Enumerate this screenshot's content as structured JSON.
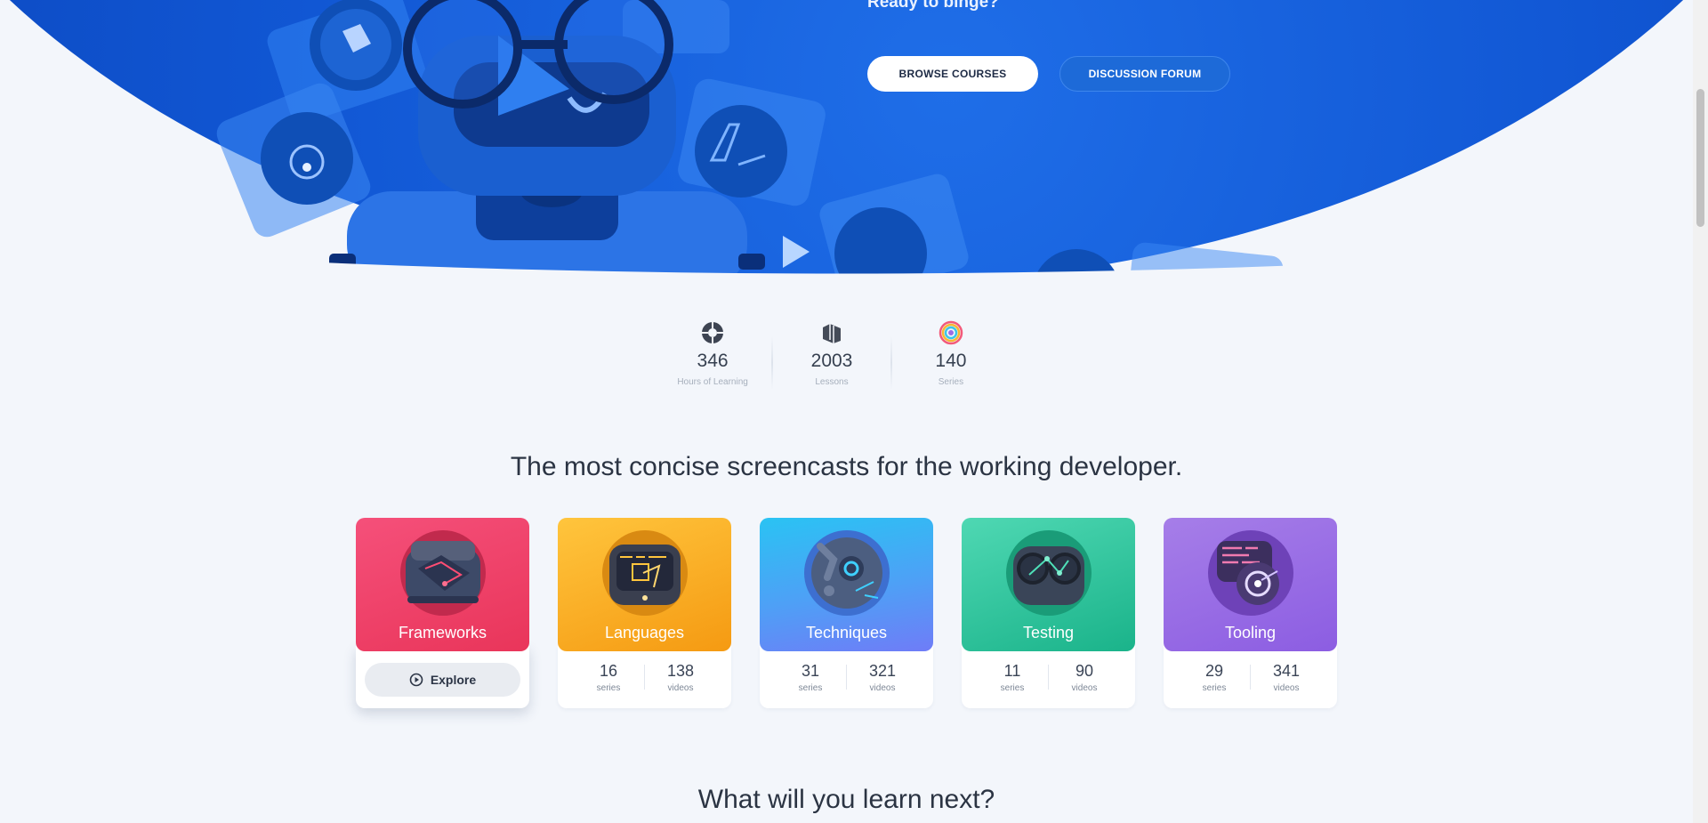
{
  "hero": {
    "tagline": "Ready to binge?",
    "browse_label": "BROWSE COURSES",
    "forum_label": "DISCUSSION FORUM"
  },
  "stats": [
    {
      "value": "346",
      "label": "Hours of Learning",
      "icon": "brain-icon"
    },
    {
      "value": "2003",
      "label": "Lessons",
      "icon": "books-icon"
    },
    {
      "value": "140",
      "label": "Series",
      "icon": "rainbow-circle-icon"
    }
  ],
  "headline": "The most concise screencasts for the working developer.",
  "next_heading": "What will you learn next?",
  "categories": [
    {
      "title": "Frameworks",
      "explore_label": "Explore",
      "color": "#e9355a"
    },
    {
      "title": "Languages",
      "series": "16",
      "series_label": "series",
      "videos": "138",
      "videos_label": "videos",
      "color": "#f59a12"
    },
    {
      "title": "Techniques",
      "series": "31",
      "series_label": "series",
      "videos": "321",
      "videos_label": "videos",
      "color": "#4ea0f6"
    },
    {
      "title": "Testing",
      "series": "11",
      "series_label": "series",
      "videos": "90",
      "videos_label": "videos",
      "color": "#1ab38a"
    },
    {
      "title": "Tooling",
      "series": "29",
      "series_label": "series",
      "videos": "341",
      "videos_label": "videos",
      "color": "#8c5de2"
    }
  ],
  "colors": {
    "hero_blue": "#1157d4",
    "page_bg": "#f3f6fb"
  }
}
